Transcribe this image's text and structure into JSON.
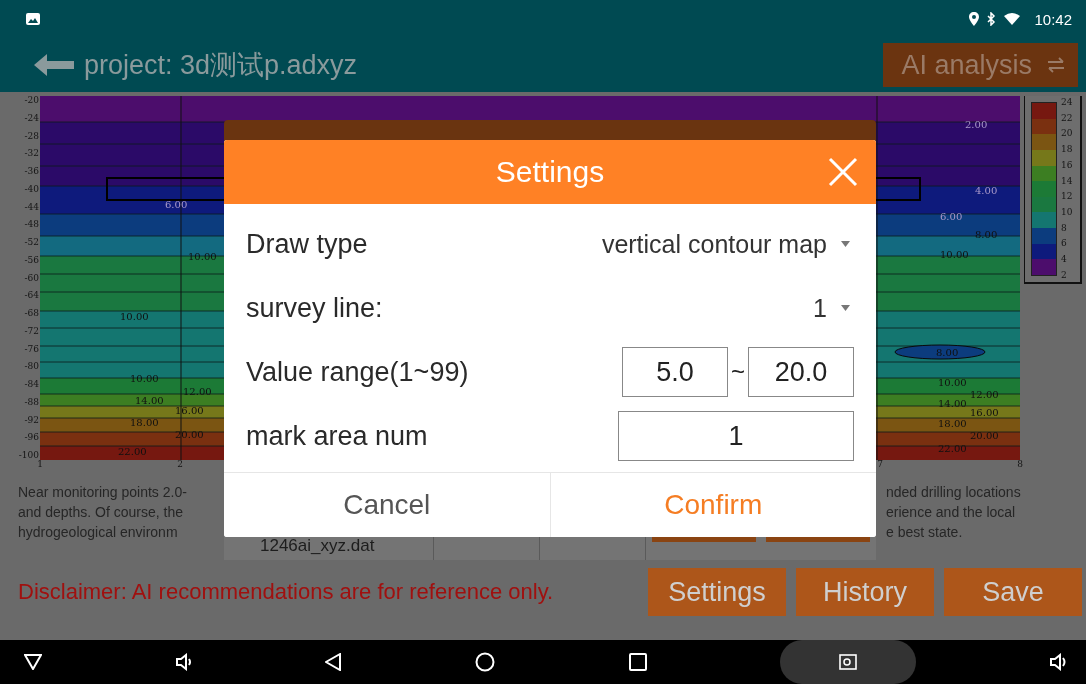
{
  "status_bar": {
    "time": "10:42"
  },
  "app_bar": {
    "title": "project: 3d测试p.adxyz",
    "action": "AI analysis"
  },
  "chart": {
    "y_labels": [
      "-20",
      "-24",
      "-28",
      "-32",
      "-36",
      "-40",
      "-44",
      "-48",
      "-52",
      "-56",
      "-60",
      "-64",
      "-68",
      "-72",
      "-76",
      "-80",
      "-84",
      "-88",
      "-92",
      "-96",
      "-100"
    ],
    "x_labels": [
      "1",
      "2",
      "7",
      "8"
    ],
    "contour_labels": [
      "6.00",
      "10.00",
      "10.00",
      "10.00",
      "12.00",
      "14.00",
      "16.00",
      "18.00",
      "20.00",
      "22.00",
      "2.00",
      "4.00",
      "6.00",
      "8.00",
      "10.00",
      "8.00",
      "10.00",
      "12.00",
      "14.00",
      "16.00",
      "18.00",
      "20.00",
      "22.00"
    ],
    "legend_labels": [
      "24",
      "22",
      "20",
      "18",
      "16",
      "14",
      "12",
      "10",
      "8",
      "6",
      "4",
      "2"
    ]
  },
  "description": {
    "left_lines": [
      "Near monitoring points 2.0-",
      "and depths. Of course, the",
      "hydrogeological environm"
    ],
    "right_lines": [
      "nded drilling locations",
      "erience and the local",
      "e best state."
    ]
  },
  "background_dialog": {
    "file": "1246ai_xyz.dat"
  },
  "disclaimer": "Disclaimer: AI recommendations are for reference only.",
  "buttons": [
    "Settings",
    "History",
    "Save"
  ],
  "dialog": {
    "title": "Settings",
    "fields": [
      {
        "kind": "select",
        "label": "Draw type",
        "value": "vertical contour map"
      },
      {
        "kind": "select",
        "label": "survey line:",
        "value": "1"
      },
      {
        "kind": "range",
        "label": "Value range(1~99)",
        "from": "5.0",
        "separator": "~",
        "to": "20.0"
      },
      {
        "kind": "input",
        "label": "mark area num",
        "value": "1"
      }
    ],
    "cancel": "Cancel",
    "confirm": "Confirm"
  }
}
